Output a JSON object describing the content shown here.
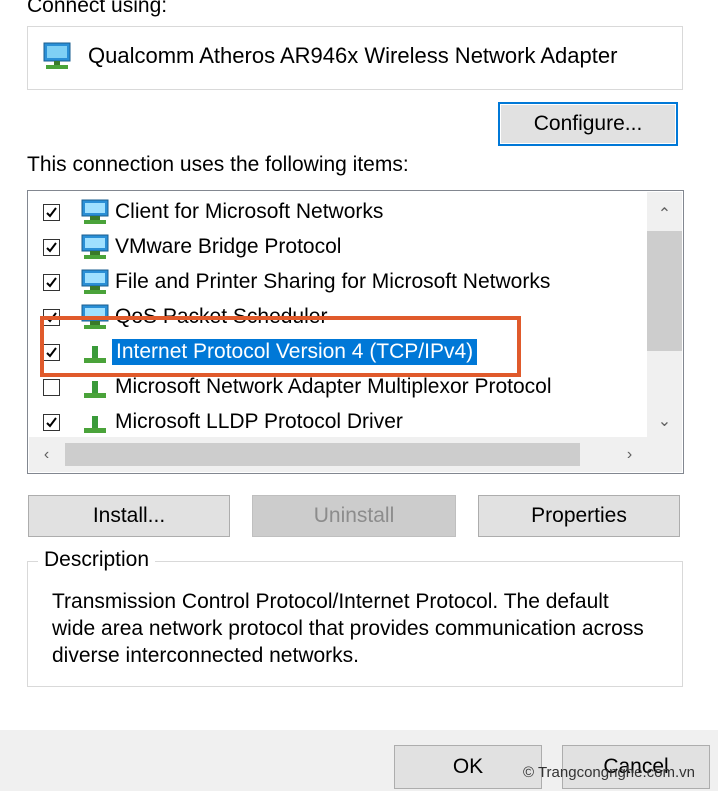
{
  "section_connect_label": "Connect using:",
  "adapter": {
    "name": "Qualcomm Atheros AR946x Wireless Network Adapter",
    "icon": "network-adapter-icon"
  },
  "buttons": {
    "configure": "Configure...",
    "install": "Install...",
    "uninstall": "Uninstall",
    "properties": "Properties",
    "ok": "OK",
    "cancel": "Cancel"
  },
  "items_label": "This connection uses the following items:",
  "items": [
    {
      "label": "Client for Microsoft Networks",
      "checked": true,
      "icon": "network-client-icon"
    },
    {
      "label": "VMware Bridge Protocol",
      "checked": true,
      "icon": "network-service-icon"
    },
    {
      "label": "File and Printer Sharing for Microsoft Networks",
      "checked": true,
      "icon": "network-service-icon"
    },
    {
      "label": "QoS Packet Scheduler",
      "checked": true,
      "icon": "network-service-icon"
    },
    {
      "label": "Internet Protocol Version 4 (TCP/IPv4)",
      "checked": true,
      "icon": "protocol-icon",
      "selected": true
    },
    {
      "label": "Microsoft Network Adapter Multiplexor Protocol",
      "checked": false,
      "icon": "protocol-icon"
    },
    {
      "label": "Microsoft LLDP Protocol Driver",
      "checked": true,
      "icon": "protocol-icon"
    }
  ],
  "description": {
    "legend": "Description",
    "text": "Transmission Control Protocol/Internet Protocol. The default wide area network protocol that provides communication across diverse interconnected networks."
  },
  "watermark": "© Trangcongnghe.com.vn",
  "colors": {
    "selection": "#0078d7",
    "highlight_box": "#e05a2b",
    "button_face": "#e1e1e1"
  }
}
